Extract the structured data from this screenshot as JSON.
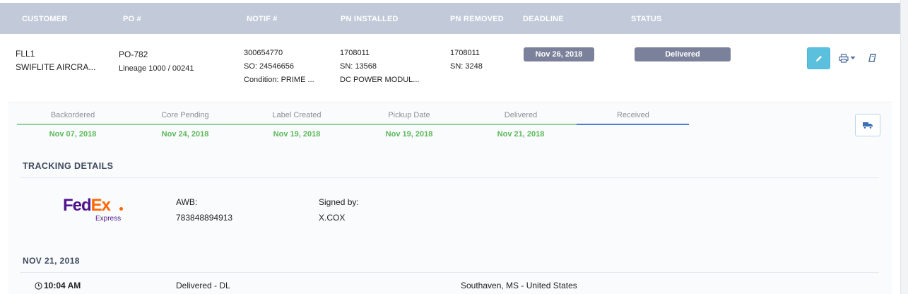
{
  "header": {
    "columns": [
      "CUSTOMER",
      "PO #",
      "NOTIF #",
      "PN INSTALLED",
      "PN REMOVED",
      "DEADLINE",
      "STATUS"
    ]
  },
  "row": {
    "customer_code": "FLL1",
    "customer_name": "SWIFLITE AIRCRA...",
    "po": "PO-782",
    "po_sub": "Lineage 1000 / 00241",
    "notif": "300654770",
    "so": "SO: 24546656",
    "condition": "Condition: PRIME ...",
    "pn_installed": "1708011",
    "pn_installed_sn": "SN: 13568",
    "pn_installed_desc": "DC POWER MODUL...",
    "pn_removed": "1708011",
    "pn_removed_sn": "SN: 3248",
    "deadline": "Nov 26, 2018",
    "status": "Delivered",
    "icons": {
      "edit": "pencil-icon",
      "print": "print-icon",
      "print_caret": "caret-down-icon",
      "book": "book-icon"
    }
  },
  "progress": {
    "steps": [
      {
        "label": "Backordered",
        "date": "Nov 07, 2018"
      },
      {
        "label": "Core Pending",
        "date": "Nov 24, 2018"
      },
      {
        "label": "Label Created",
        "date": "Nov 19, 2018"
      },
      {
        "label": "Pickup Date",
        "date": "Nov 19, 2018"
      },
      {
        "label": "Delivered",
        "date": "Nov 21, 2018"
      },
      {
        "label": "Received",
        "date": ""
      }
    ],
    "colors": {
      "complete": "#8fd19e",
      "current": "#4a7fd4",
      "date": "#5cb85c"
    },
    "truck_icon": "truck-icon"
  },
  "tracking": {
    "title": "TRACKING DETAILS",
    "carrier_logo": {
      "fe": "Fed",
      "ex": "Ex",
      "sub": "Express"
    },
    "awb_label": "AWB:",
    "awb_value": "783848894913",
    "signed_label": "Signed by:",
    "signed_value": "X.COX",
    "events_date": "NOV 21, 2018",
    "event": {
      "time": "10:04 AM",
      "description": "Delivered - DL",
      "location": "Southaven, MS - United States",
      "clock_icon": "clock-icon"
    }
  }
}
